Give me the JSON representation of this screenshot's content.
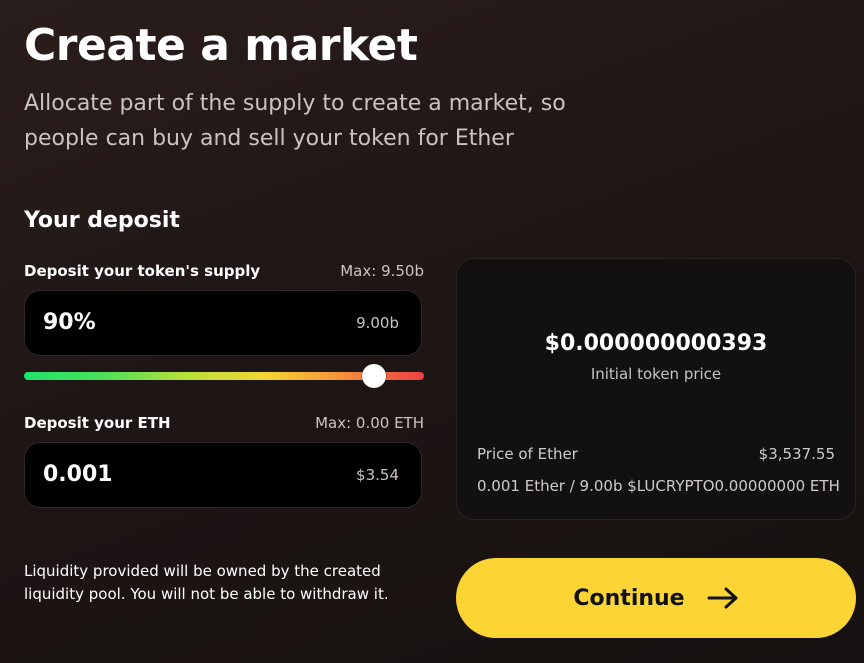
{
  "header": {
    "title": "Create a market",
    "subtitle": "Allocate part of the supply to create a market, so people can buy and sell your token for Ether"
  },
  "deposit": {
    "section_title": "Your deposit",
    "token": {
      "label": "Deposit your token's supply",
      "max": "Max: 9.50b",
      "value": "90%",
      "amount": "9.00b",
      "slider_fraction": 0.9
    },
    "eth": {
      "label": "Deposit your ETH",
      "max": "Max: 0.00 ETH",
      "value": "0.001",
      "usd": "$3.54"
    },
    "note": "Liquidity provided will be owned by the created liquidity pool. You will not be able to withdraw it."
  },
  "summary": {
    "initial_price": "$0.000000000393",
    "initial_price_caption": "Initial token price",
    "ether_price_label": "Price of Ether",
    "ether_price_value": "$3,537.55",
    "ratio_label": "0.001 Ether / 9.00b $LUCRYPTO",
    "ratio_value": "0.00000000 ETH"
  },
  "actions": {
    "continue_label": "Continue",
    "continue_icon": "arrow-right-icon"
  },
  "colors": {
    "accent": "#fcd535",
    "background": "#1e1615"
  }
}
